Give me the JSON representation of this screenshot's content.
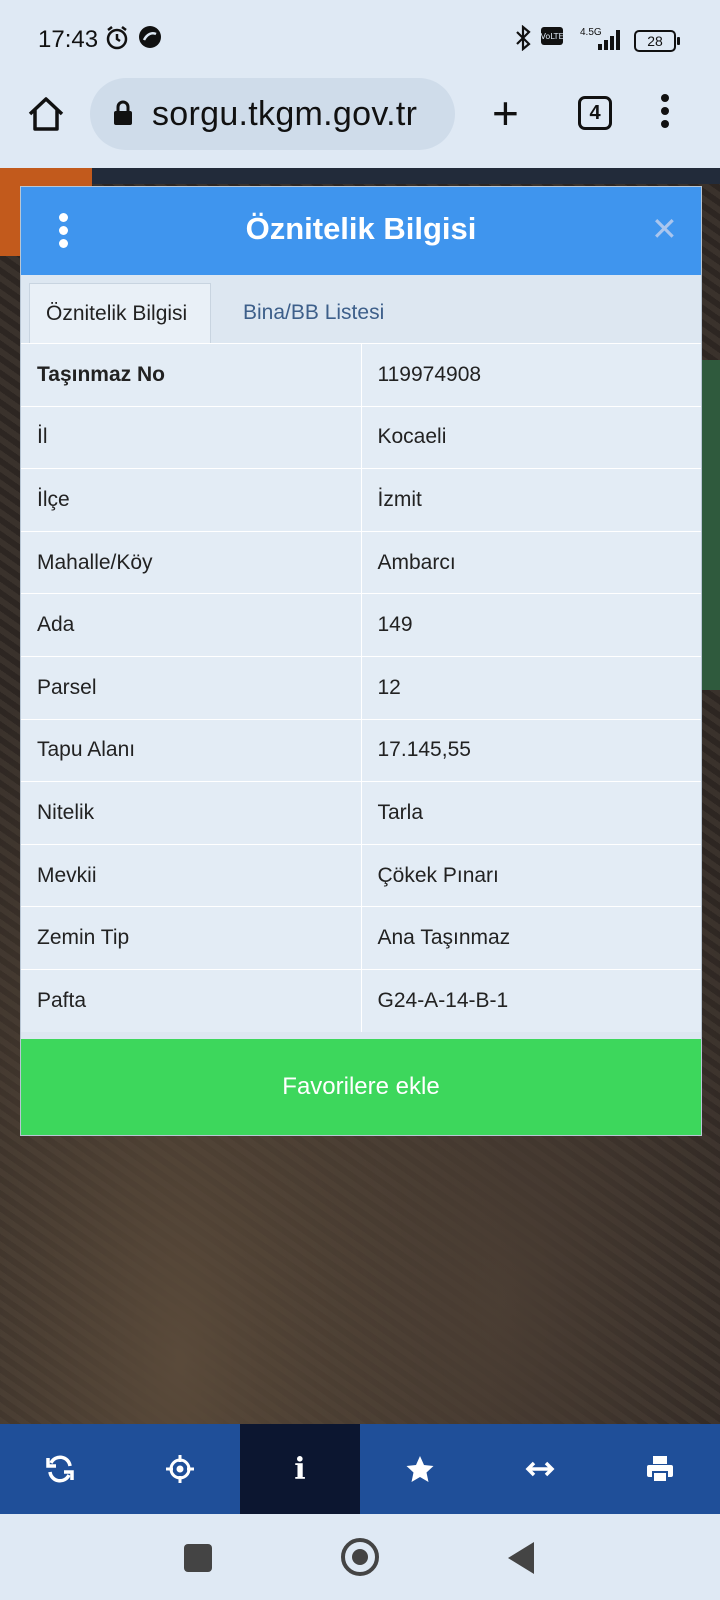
{
  "status_bar": {
    "time": "17:43",
    "network": "4.5G",
    "battery": "28"
  },
  "browser": {
    "url": "sorgu.tkgm.gov.tr",
    "tab_count": "4"
  },
  "dialog": {
    "title": "Öznitelik Bilgisi",
    "tabs": [
      {
        "label": "Öznitelik Bilgisi",
        "active": true
      },
      {
        "label": "Bina/BB Listesi",
        "active": false
      }
    ],
    "rows": [
      {
        "key": "Taşınmaz No",
        "value": "119974908"
      },
      {
        "key": "İl",
        "value": "Kocaeli"
      },
      {
        "key": "İlçe",
        "value": "İzmit"
      },
      {
        "key": "Mahalle/Köy",
        "value": "Ambarcı"
      },
      {
        "key": "Ada",
        "value": "149"
      },
      {
        "key": "Parsel",
        "value": "12"
      },
      {
        "key": "Tapu Alanı",
        "value": "17.145,55"
      },
      {
        "key": "Nitelik",
        "value": "Tarla"
      },
      {
        "key": "Mevkii",
        "value": "Çökek Pınarı"
      },
      {
        "key": "Zemin Tip",
        "value": "Ana Taşınmaz"
      },
      {
        "key": "Pafta",
        "value": "G24-A-14-B-1"
      }
    ],
    "favorite_button": "Favorilere ekle"
  },
  "toolbar": {
    "tools": [
      "refresh-icon",
      "locate-icon",
      "info-icon",
      "star-icon",
      "measure-icon",
      "print-icon"
    ],
    "active_tool": "info-icon",
    "info_glyph": "i"
  },
  "colors": {
    "header_blue": "#3f95ee",
    "favorite_green": "#3dd75c",
    "toolbar_blue": "#1f4f99",
    "toolbar_active": "#0c1630"
  }
}
